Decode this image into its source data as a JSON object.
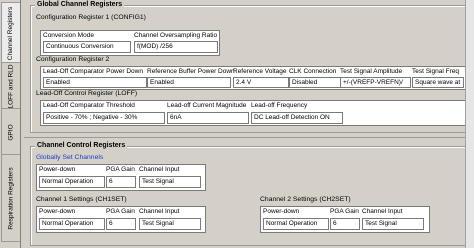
{
  "tabs": [
    "Channel Registers",
    "LOFF and RLD",
    "GPIO",
    "Respiration Registers"
  ],
  "global": {
    "title": "Global Channel Registers",
    "config1": {
      "title": "Configuration Register 1 (CONFIG1)",
      "headers": [
        "Conversion Mode",
        "Channel Oversampling Ratio"
      ],
      "values": [
        "Continuous Conversion",
        "f(MOD) /256"
      ]
    },
    "config2": {
      "title": "Configuration Register 2",
      "headers": [
        "Lead-Off Comparator Power Down",
        "Reference Buffer Power Down",
        "Reference Voltage",
        "CLK Connection",
        "Test Signal Amplitude",
        "Test Signal Freq"
      ],
      "values": [
        "Enabled",
        "Enabled",
        "2.4 V",
        "Disabled",
        "+/-(VREFP-VREFN)/",
        "Square wave at"
      ]
    },
    "loff": {
      "title": "Lead-Off Control Register (LOFF)",
      "headers": [
        "Lead-Off Comparator Threshold",
        "Lead-off Current Magnitude",
        "Lead-off Frequency"
      ],
      "values": [
        "Positive - 70% ; Negative - 30%",
        "6nA",
        "DC Lead-off Detection ON"
      ]
    }
  },
  "channel": {
    "title": "Channel Control Registers",
    "global_link": "Globally Set Channels",
    "global_headers": [
      "Power-down",
      "PGA Gain",
      "Channel Input"
    ],
    "global_values": [
      "Normal Operation",
      "6",
      "Test  Signal"
    ],
    "ch1": {
      "title": "Channel 1 Settings (CH1SET)",
      "headers": [
        "Power-down",
        "PGA Gain",
        "Channel Input"
      ],
      "values": [
        "Normal Operation",
        "6",
        "Test  Signal"
      ]
    },
    "ch2": {
      "title": "Channel 2 Settings (CH2SET)",
      "headers": [
        "Power-down",
        "PGA Gain",
        "Channel Input"
      ],
      "values": [
        "Normal Operation",
        "6",
        "Test  Signal"
      ]
    }
  }
}
